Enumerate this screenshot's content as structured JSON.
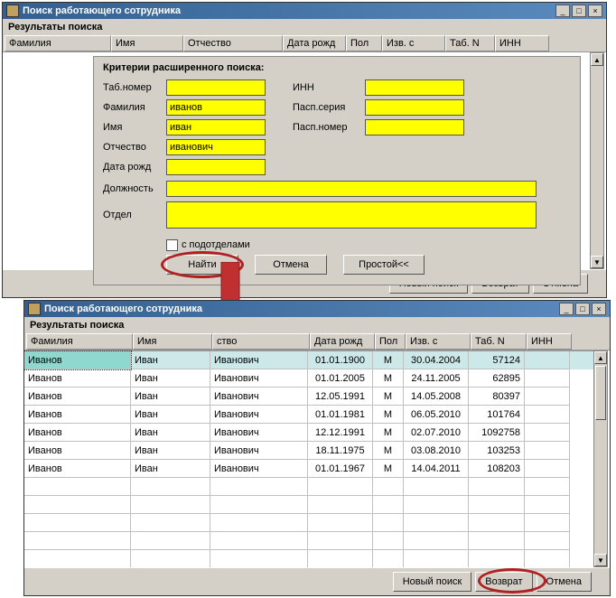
{
  "win1": {
    "title": "Поиск работающего сотрудника",
    "section": "Результаты поиска",
    "cols": {
      "fam": "Фамилия",
      "imya": "Имя",
      "otch": "Отчество",
      "dob": "Дата рожд",
      "pol": "Пол",
      "izv": "Изв. с",
      "tabn": "Таб. N",
      "inn": "ИНН"
    },
    "panel": {
      "title": "Критерии расширенного поиска:",
      "labels": {
        "tabnomer": "Таб.номер",
        "fam": "Фамилия",
        "imya": "Имя",
        "otch": "Отчество",
        "dob": "Дата рожд",
        "dolj": "Должность",
        "otdel": "Отдел",
        "inn": "ИНН",
        "pasps": "Пасп.серия",
        "paspn": "Пасп.номер",
        "subdept": "с подотделами"
      },
      "values": {
        "tabnomer": "",
        "fam": "иванов",
        "imya": "иван",
        "otch": "иванович",
        "dob": "",
        "dolj": "",
        "otdel": "",
        "inn": "",
        "pasps": "",
        "paspn": ""
      },
      "buttons": {
        "find": "Найти",
        "cancel": "Отмена",
        "simple": "Простой<<"
      }
    },
    "footer": {
      "newsearch": "Новый поиск",
      "vozvrat": "Возврат",
      "otmena": "Отмена"
    }
  },
  "win2": {
    "title": "Поиск работающего сотрудника",
    "section": "Результаты поиска",
    "cols": {
      "fam": "Фамилия",
      "imya": "Имя",
      "otch": "ство",
      "dob": "Дата рожд",
      "pol": "Пол",
      "izv": "Изв. с",
      "tabn": "Таб. N",
      "inn": "ИНН"
    },
    "rows": [
      {
        "fam": "Иванов",
        "imya": "Иван",
        "otch": "Иванович",
        "dob": "01.01.1900",
        "pol": "М",
        "izv": "30.04.2004",
        "tabn": "57124",
        "inn": ""
      },
      {
        "fam": "Иванов",
        "imya": "Иван",
        "otch": "Иванович",
        "dob": "01.01.2005",
        "pol": "М",
        "izv": "24.11.2005",
        "tabn": "62895",
        "inn": ""
      },
      {
        "fam": "Иванов",
        "imya": "Иван",
        "otch": "Иванович",
        "dob": "12.05.1991",
        "pol": "М",
        "izv": "14.05.2008",
        "tabn": "80397",
        "inn": ""
      },
      {
        "fam": "Иванов",
        "imya": "Иван",
        "otch": "Иванович",
        "dob": "01.01.1981",
        "pol": "М",
        "izv": "06.05.2010",
        "tabn": "101764",
        "inn": ""
      },
      {
        "fam": "Иванов",
        "imya": "Иван",
        "otch": "Иванович",
        "dob": "12.12.1991",
        "pol": "М",
        "izv": "02.07.2010",
        "tabn": "1092758",
        "inn": ""
      },
      {
        "fam": "Иванов",
        "imya": "Иван",
        "otch": "Иванович",
        "dob": "18.11.1975",
        "pol": "М",
        "izv": "03.08.2010",
        "tabn": "103253",
        "inn": ""
      },
      {
        "fam": "Иванов",
        "imya": "Иван",
        "otch": "Иванович",
        "dob": "01.01.1967",
        "pol": "М",
        "izv": "14.04.2011",
        "tabn": "108203",
        "inn": ""
      }
    ],
    "footer": {
      "newsearch": "Новый поиск",
      "vozvrat": "Возврат",
      "otmena": "Отмена"
    }
  }
}
